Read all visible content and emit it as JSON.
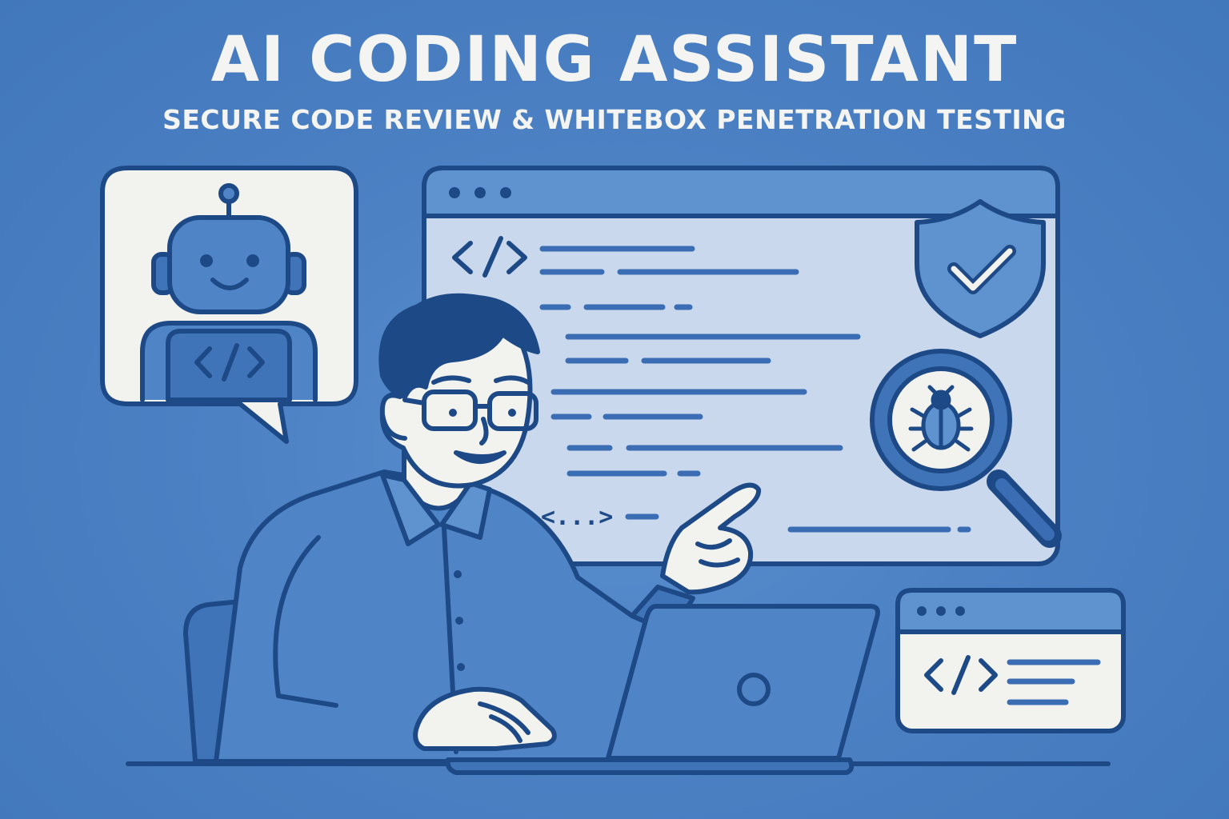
{
  "header": {
    "title": "AI CODING ASSISTANT",
    "subtitle": "SECURE CODE REVIEW & WHITEBOX PENETRATION TESTING"
  },
  "code_window": {
    "bottom_tag": "<...>"
  },
  "icons": {
    "assistant": "robot-icon",
    "security": "shield-check-icon",
    "scan": "magnifier-bug-icon",
    "code": "code-brackets-icon"
  },
  "colors": {
    "background": "#4a80c2",
    "outline": "#1d4a86",
    "panel": "#f2f2ef",
    "window_body": "#c9d8ec",
    "accent": "#3d6fb2"
  }
}
